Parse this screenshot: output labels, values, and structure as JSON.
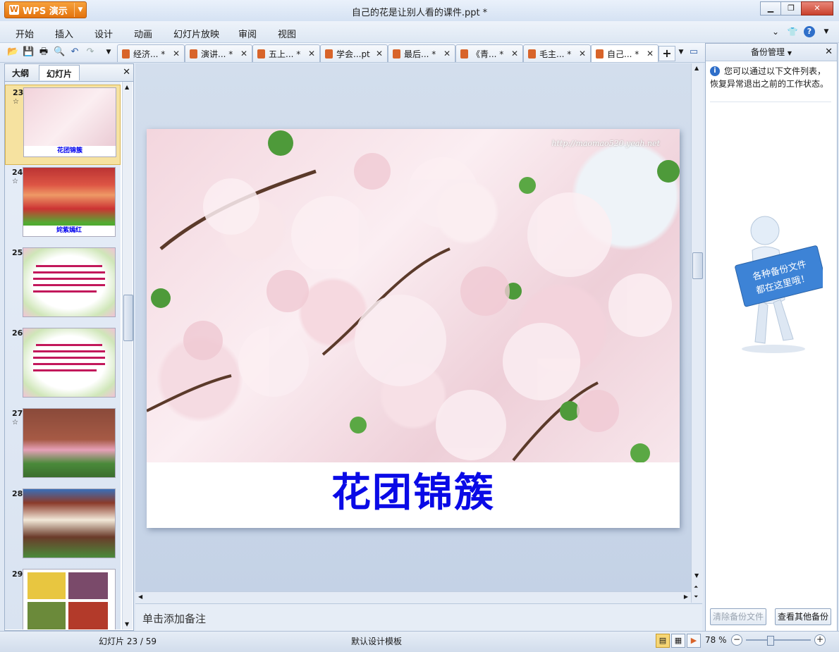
{
  "app": {
    "button_label": "WPS 演示",
    "window_title": "自己的花是让别人看的课件.ppt *"
  },
  "menu": {
    "items": [
      "开始",
      "插入",
      "设计",
      "动画",
      "幻灯片放映",
      "审阅",
      "视图"
    ]
  },
  "tabs": [
    {
      "label": "经济... *"
    },
    {
      "label": "演讲... *"
    },
    {
      "label": "五上... *"
    },
    {
      "label": "学会...pt"
    },
    {
      "label": "最后... *"
    },
    {
      "label": "《青... *"
    },
    {
      "label": "毛主... *"
    },
    {
      "label": "自己... *",
      "active": true
    }
  ],
  "left_pane": {
    "tab_outline": "大纲",
    "tab_slides": "幻灯片",
    "slides": [
      {
        "number": "23",
        "caption": "花团锦簇",
        "selected": true,
        "star": true,
        "kind": "blossom"
      },
      {
        "number": "24",
        "caption": "姹紫嫣红",
        "star": true,
        "kind": "tulips"
      },
      {
        "number": "25",
        "kind": "text"
      },
      {
        "number": "26",
        "kind": "text"
      },
      {
        "number": "27",
        "star": true,
        "kind": "house"
      },
      {
        "number": "28",
        "kind": "building"
      },
      {
        "number": "29",
        "kind": "grid"
      }
    ]
  },
  "slide": {
    "watermark": "http://maomao520.yeah.net",
    "title": "花团锦簇"
  },
  "notes": {
    "placeholder": "单击添加备注"
  },
  "right_pane": {
    "title": "备份管理",
    "info": "您可以通过以下文件列表，恢复异常退出之前的工作状态。",
    "sign_text_line1": "各种备份文件",
    "sign_text_line2": "都在这里哦！",
    "clear_button": "清除备份文件",
    "view_button": "查看其他备份"
  },
  "status": {
    "slide_indicator": "幻灯片 23 / 59",
    "template": "默认设计模板",
    "zoom": "78 %",
    "zoom_level": 78
  },
  "colors": {
    "accent": "#e3730e",
    "title_blue": "#0a0ae6"
  }
}
